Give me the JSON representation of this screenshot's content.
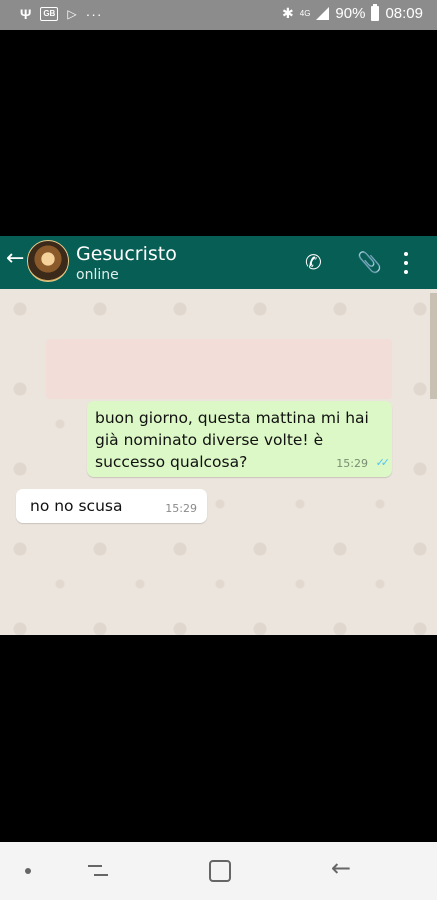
{
  "status_bar": {
    "usb_icon": "usb-icon",
    "gallery_icon": "gallery-icon",
    "gallery_label": "GB",
    "play_icon": "play-store-icon",
    "more_label": "···",
    "bluetooth_icon": "bluetooth-icon",
    "network_label": "4G",
    "battery": "90%",
    "time": "08:09"
  },
  "chat": {
    "contact_name": "Gesucristo",
    "contact_status": "online",
    "back_icon": "back-arrow-icon",
    "call_icon": "phone-icon",
    "attach_icon": "paperclip-icon",
    "menu_icon": "more-vert-icon",
    "messages": [
      {
        "direction": "outgoing",
        "text": "buon giorno, questa mattina mi hai già nominato diverse volte! è successo qualcosa?",
        "time": "15:29",
        "status": "read"
      },
      {
        "direction": "incoming",
        "text": "no no scusa",
        "time": "15:29"
      }
    ]
  },
  "colors": {
    "header": "#075e54",
    "outgoing_bubble": "#dcf8c6",
    "incoming_bubble": "#ffffff",
    "chat_background": "#ece5dd",
    "read_ticks": "#4fc3f7"
  },
  "nav_bar": {
    "dot_icon": "nav-dot-icon",
    "recent_icon": "recent-apps-icon",
    "home_icon": "home-icon",
    "back_icon": "nav-back-icon"
  }
}
